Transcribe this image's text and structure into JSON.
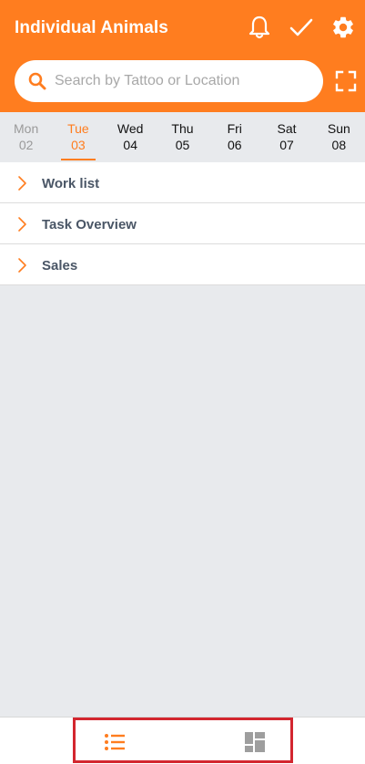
{
  "header": {
    "title": "Individual Animals",
    "icons": [
      "bell-icon",
      "check-icon",
      "gear-icon"
    ]
  },
  "search": {
    "placeholder": "Search by Tattoo or Location",
    "value": ""
  },
  "days": [
    {
      "name": "Mon",
      "date": "02",
      "state": "past"
    },
    {
      "name": "Tue",
      "date": "03",
      "state": "active"
    },
    {
      "name": "Wed",
      "date": "04",
      "state": "future"
    },
    {
      "name": "Thu",
      "date": "05",
      "state": "future"
    },
    {
      "name": "Fri",
      "date": "06",
      "state": "future"
    },
    {
      "name": "Sat",
      "date": "07",
      "state": "future"
    },
    {
      "name": "Sun",
      "date": "08",
      "state": "future"
    }
  ],
  "sections": [
    {
      "label": "Work list"
    },
    {
      "label": "Task Overview"
    },
    {
      "label": "Sales"
    }
  ],
  "bottom_nav": {
    "items": [
      {
        "icon": "list-icon",
        "active": true
      },
      {
        "icon": "dashboard-icon",
        "active": false
      }
    ]
  },
  "colors": {
    "accent": "#ff7d1f",
    "background": "#e8eaed",
    "label": "#4a5666",
    "highlight_frame": "#d3262f"
  }
}
